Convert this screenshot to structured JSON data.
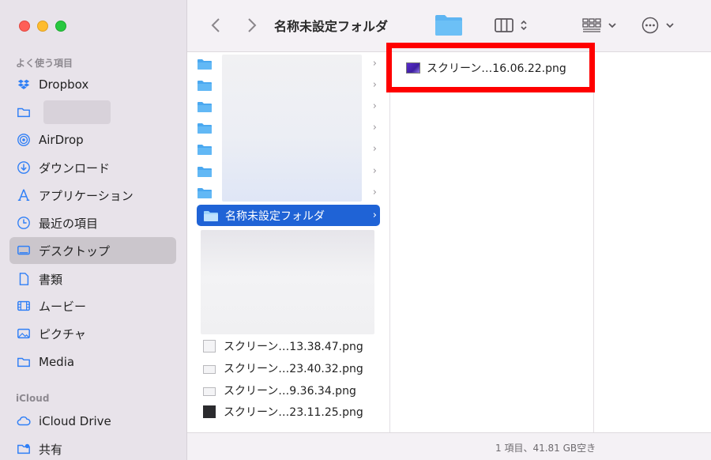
{
  "toolbar": {
    "title": "名称未設定フォルダ",
    "back_icon": "chevron-left",
    "forward_icon": "chevron-right"
  },
  "sidebar": {
    "favorites_header": "よく使う項目",
    "items": [
      {
        "label": "Dropbox",
        "icon": "dropbox-icon"
      },
      {
        "label": "",
        "icon": "folder-icon"
      },
      {
        "label": "AirDrop",
        "icon": "airdrop-icon"
      },
      {
        "label": "ダウンロード",
        "icon": "download-icon"
      },
      {
        "label": "アプリケーション",
        "icon": "applications-icon"
      },
      {
        "label": "最近の項目",
        "icon": "clock-icon"
      },
      {
        "label": "デスクトップ",
        "icon": "desktop-icon"
      },
      {
        "label": "書類",
        "icon": "document-icon"
      },
      {
        "label": "ムービー",
        "icon": "film-icon"
      },
      {
        "label": "ピクチャ",
        "icon": "photo-icon"
      },
      {
        "label": "Media",
        "icon": "folder-icon"
      }
    ],
    "icloud_header": "iCloud",
    "icloud_items": [
      {
        "label": "iCloud Drive",
        "icon": "cloud-icon"
      },
      {
        "label": "共有",
        "icon": "shared-folder-icon"
      }
    ]
  },
  "column1": {
    "selected_folder": "名称未設定フォルダ",
    "files": [
      "スクリーン…13.38.47.png",
      "スクリーン…23.40.32.png",
      "スクリーン…9.36.34.png",
      "スクリーン…23.11.25.png"
    ]
  },
  "column2": {
    "file": "スクリーン…16.06.22.png"
  },
  "status": {
    "text": "1 項目、41.81 GB空き"
  },
  "colors": {
    "accent": "#1f63d6",
    "highlight_box": "#ff0000",
    "folder_blue": "#4aa8f0"
  }
}
